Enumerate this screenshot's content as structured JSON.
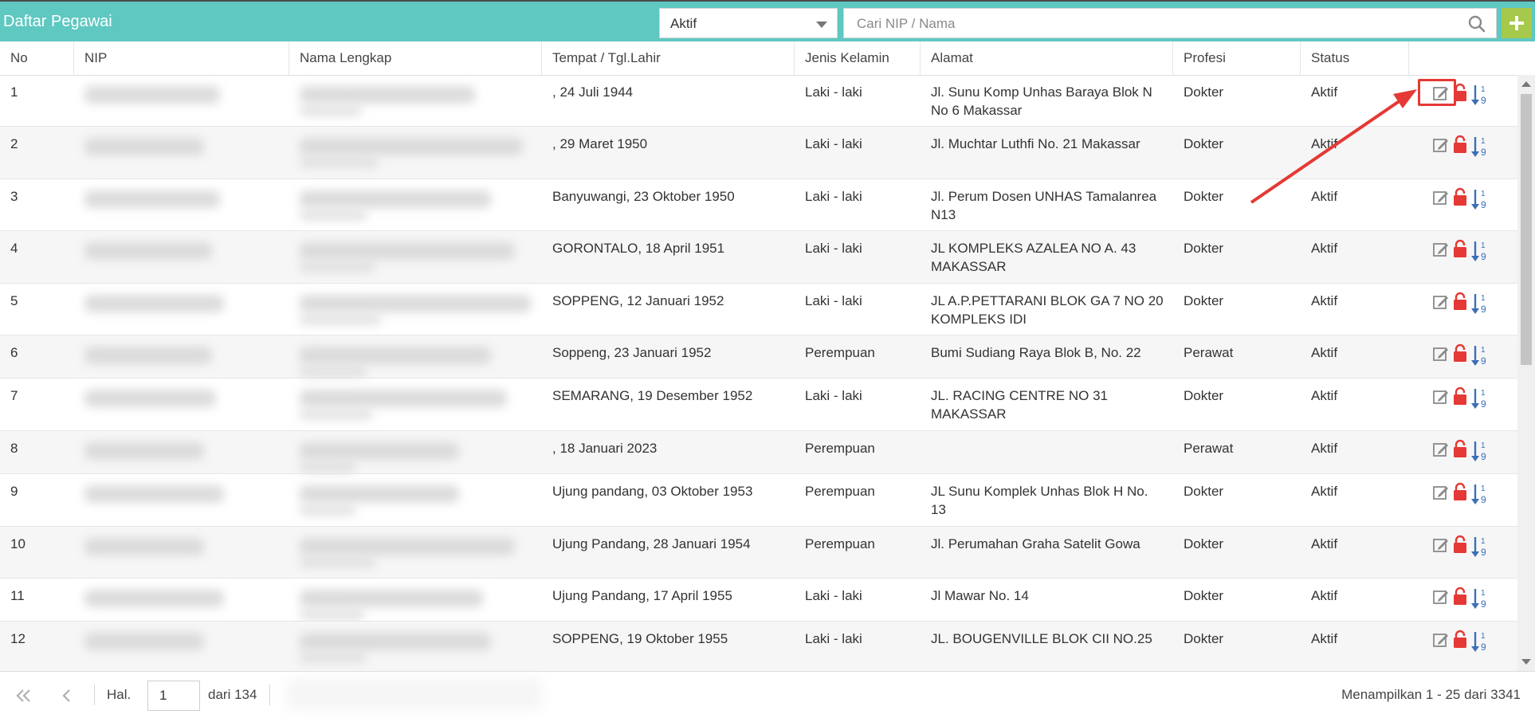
{
  "app": {
    "title": "Daftar Pegawai",
    "status_filter": "Aktif",
    "search_placeholder": "Cari NIP / Nama",
    "search_value": ""
  },
  "columns": [
    "No",
    "NIP",
    "Nama Lengkap",
    "Tempat / Tgl.Lahir",
    "Jenis Kelamin",
    "Alamat",
    "Profesi",
    "Status"
  ],
  "rows": [
    {
      "no": "1",
      "ttl": ", 24 Juli 1944",
      "jk": "Laki - laki",
      "alamat": "Jl. Sunu Komp Unhas Baraya Blok N No 6 Makassar",
      "profesi": "Dokter",
      "status": "Aktif"
    },
    {
      "no": "2",
      "ttl": ", 29 Maret 1950",
      "jk": "Laki - laki",
      "alamat": "Jl. Muchtar Luthfi No. 21 Makassar",
      "profesi": "Dokter",
      "status": "Aktif"
    },
    {
      "no": "3",
      "ttl": "Banyuwangi, 23 Oktober 1950",
      "jk": "Laki - laki",
      "alamat": "Jl. Perum Dosen UNHAS Tamalanrea N13",
      "profesi": "Dokter",
      "status": "Aktif"
    },
    {
      "no": "4",
      "ttl": "GORONTALO, 18 April 1951",
      "jk": "Laki - laki",
      "alamat": "JL KOMPLEKS AZALEA NO A. 43 MAKASSAR",
      "profesi": "Dokter",
      "status": "Aktif"
    },
    {
      "no": "5",
      "ttl": "SOPPENG, 12 Januari 1952",
      "jk": "Laki - laki",
      "alamat": "JL A.P.PETTARANI BLOK GA 7 NO 20 KOMPLEKS IDI",
      "profesi": "Dokter",
      "status": "Aktif"
    },
    {
      "no": "6",
      "ttl": "Soppeng, 23 Januari 1952",
      "jk": "Perempuan",
      "alamat": "Bumi Sudiang Raya Blok B, No. 22",
      "profesi": "Perawat",
      "status": "Aktif"
    },
    {
      "no": "7",
      "ttl": "SEMARANG, 19 Desember 1952",
      "jk": "Laki - laki",
      "alamat": "JL. RACING CENTRE NO 31 MAKASSAR",
      "profesi": "Dokter",
      "status": "Aktif"
    },
    {
      "no": "8",
      "ttl": ", 18 Januari 2023",
      "jk": "Perempuan",
      "alamat": "",
      "profesi": "Perawat",
      "status": "Aktif"
    },
    {
      "no": "9",
      "ttl": "Ujung pandang, 03 Oktober 1953",
      "jk": "Perempuan",
      "alamat": "JL Sunu Komplek Unhas Blok H No. 13",
      "profesi": "Dokter",
      "status": "Aktif"
    },
    {
      "no": "10",
      "ttl": "Ujung Pandang, 28 Januari 1954",
      "jk": "Perempuan",
      "alamat": "Jl. Perumahan Graha Satelit Gowa",
      "profesi": "Dokter",
      "status": "Aktif"
    },
    {
      "no": "11",
      "ttl": "Ujung Pandang, 17 April 1955",
      "jk": "Laki - laki",
      "alamat": "Jl Mawar No. 14",
      "profesi": "Dokter",
      "status": "Aktif"
    },
    {
      "no": "12",
      "ttl": "SOPPENG, 19 Oktober 1955",
      "jk": "Laki - laki",
      "alamat": "JL. BOUGENVILLE BLOK CII NO.25",
      "profesi": "Dokter",
      "status": "Aktif"
    }
  ],
  "action_icons": [
    "edit-icon",
    "lock-icon",
    "sort-numeric-icon"
  ],
  "pagination": {
    "page_label": "Hal.",
    "current_page": "1",
    "total_label": "dari 134",
    "info": "Menampilkan 1 - 25 dari 3341"
  },
  "colors": {
    "header_bar": "#5ec8c1",
    "add_button": "#a6c94b",
    "lock_icon": "#e53935",
    "sort_icon": "#3b6fb6",
    "highlight": "#e53935"
  }
}
